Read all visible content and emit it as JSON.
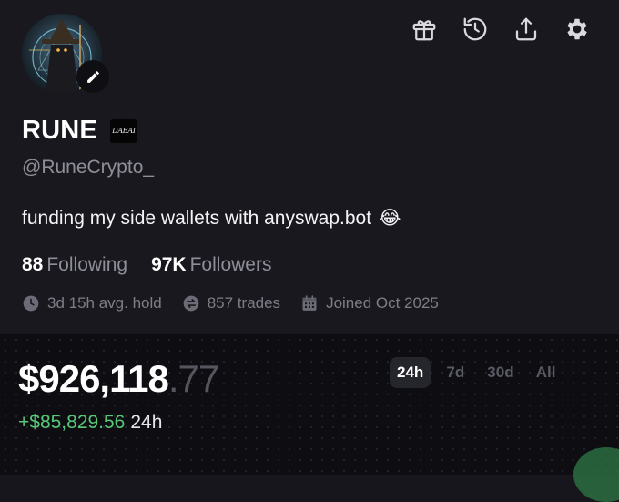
{
  "profile": {
    "display_name": "RUNE",
    "badge_text": "DABAI",
    "handle": "@RuneCrypto_",
    "bio": "funding my side wallets with anyswap.bot",
    "bio_emoji": "😂"
  },
  "stats": {
    "following_count": "88",
    "following_label": "Following",
    "followers_count": "97K",
    "followers_label": "Followers"
  },
  "meta": {
    "avg_hold": "3d 15h avg. hold",
    "trades": "857 trades",
    "joined": "Joined Oct 2025"
  },
  "portfolio": {
    "balance_main": "$926,118",
    "balance_cents": ".77",
    "change_value": "+$85,829.56",
    "change_period": "24h"
  },
  "range_tabs": {
    "items": [
      "24h",
      "7d",
      "30d",
      "All"
    ],
    "selected": "24h"
  },
  "icons": {
    "top": [
      "gift-icon",
      "history-icon",
      "share-icon",
      "settings-icon"
    ],
    "edit": "pencil-icon"
  },
  "colors": {
    "positive": "#58c878",
    "muted_text": "#8e8e98"
  }
}
